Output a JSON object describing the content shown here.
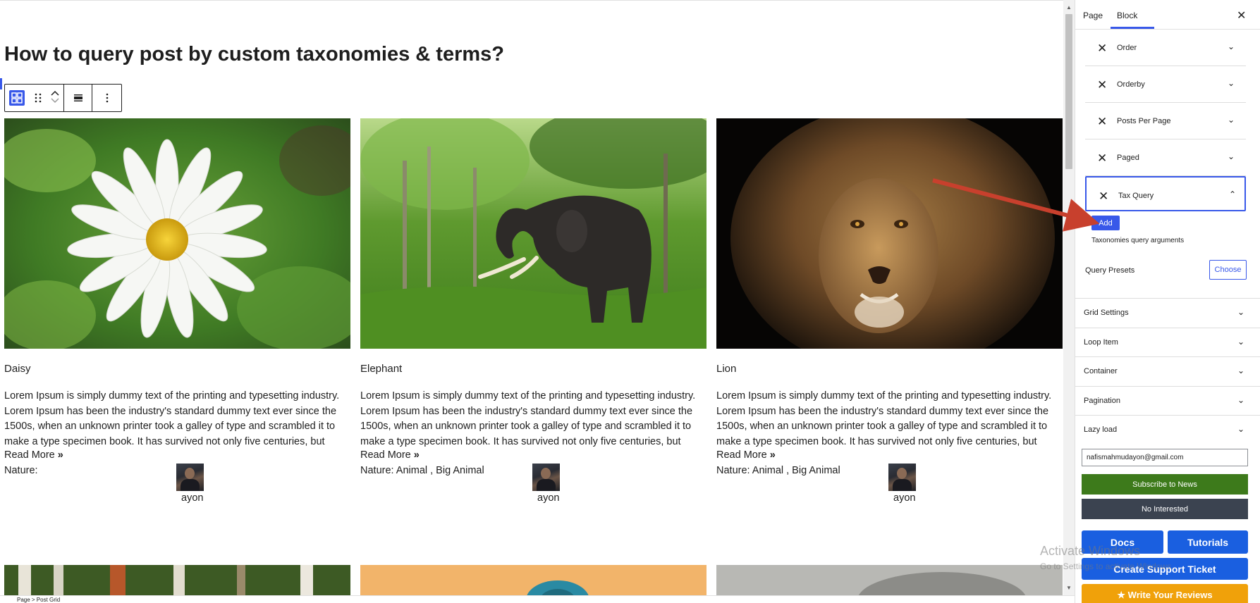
{
  "page": {
    "title": "How to query post by custom taxonomies & terms?"
  },
  "toolbar": {
    "block_icon": "grid-block-icon",
    "drag_icon": "drag-handle-icon",
    "move_up_icon": "chevron-up-icon",
    "move_down_icon": "chevron-down-icon",
    "align_icon": "align-icon",
    "more_icon": "more-vertical-icon"
  },
  "posts": [
    {
      "title": "Daisy",
      "excerpt": "Lorem Ipsum is simply dummy text of the printing and typesetting industry. Lorem Ipsum has been the industry's standard dummy text ever since the 1500s, when an unknown printer took a galley of type and scrambled it to make a type specimen book. It has survived not only five centuries, but",
      "read_more": "Read More",
      "categories": "Nature:",
      "author": "ayon"
    },
    {
      "title": "Elephant",
      "excerpt": "Lorem Ipsum is simply dummy text of the printing and typesetting industry. Lorem Ipsum has been the industry's standard dummy text ever since the 1500s, when an unknown printer took a galley of type and scrambled it to make a type specimen book. It has survived not only five centuries, but",
      "read_more": "Read More",
      "categories": "Nature: Animal , Big Animal",
      "author": "ayon"
    },
    {
      "title": "Lion",
      "excerpt": "Lorem Ipsum is simply dummy text of the printing and typesetting industry. Lorem Ipsum has been the industry's standard dummy text ever since the 1500s, when an unknown printer took a galley of type and scrambled it to make a type specimen book. It has survived not only five centuries, but",
      "read_more": "Read More",
      "categories": "Nature: Animal , Big Animal",
      "author": "ayon"
    }
  ],
  "sidebar": {
    "tabs": [
      "Page",
      "Block"
    ],
    "active_tab": "Block",
    "query_items": [
      "Order",
      "Orderby",
      "Posts Per Page",
      "Paged",
      "Tax Query"
    ],
    "add_label": "Add",
    "tax_help": "Taxonomies query arguments",
    "presets_label": "Query Presets",
    "choose_label": "Choose",
    "panels": [
      "Grid Settings",
      "Loop Item",
      "Container",
      "Pagination",
      "Lazy load"
    ],
    "email_value": "nafismahmudayon@gmail.com",
    "subscribe_label": "Subscribe to News",
    "not_interested_label": "No Interested",
    "docs_label": "Docs",
    "tutorials_label": "Tutorials",
    "ticket_label": "Create Support Ticket",
    "review_label": "Write Your Reviews"
  },
  "watermark": {
    "line1": "Activate Windows",
    "line2": "Go to Settings to activate Windows."
  },
  "breadcrumb": "Page  >  Post Grid",
  "colors": {
    "accent": "#3858e9",
    "subscribe": "#3d7a1b",
    "not_interested": "#3b4350",
    "help_buttons": "#1a5fe0",
    "review": "#f0a10a",
    "annotation_arrow": "#c8402d"
  }
}
